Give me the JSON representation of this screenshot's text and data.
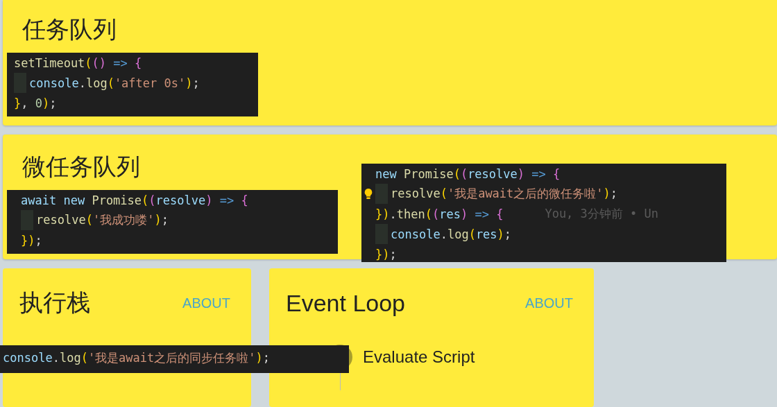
{
  "cards": [
    {
      "title": "任务队列",
      "snippets": [
        {
          "lines": [
            {
              "text": "setTimeout(() => {"
            },
            {
              "indent": true,
              "text": "console.log('after 0s');"
            },
            {
              "text": "}, 0);"
            }
          ]
        }
      ]
    },
    {
      "title": "微任务队列",
      "snippets": [
        {
          "lines": [
            {
              "text": "await new Promise((resolve) => {"
            },
            {
              "indent": true,
              "text": "resolve('我成功喽');"
            },
            {
              "text": "});"
            }
          ]
        },
        {
          "lines": [
            {
              "text": "new Promise((resolve) => {"
            },
            {
              "indent": true,
              "lightbulb": true,
              "text": "resolve('我是await之后的微任务啦');"
            },
            {
              "text": "}).then((res) => {",
              "blame": "You, 3分钟前 • Un"
            },
            {
              "indent": true,
              "text": "console.log(res);"
            },
            {
              "text": "});"
            }
          ]
        }
      ]
    }
  ],
  "panels": [
    {
      "kind": "stack",
      "title": "执行栈",
      "link": "ABOUT"
    },
    {
      "kind": "loop",
      "title": "Event Loop",
      "link": "ABOUT",
      "steps": [
        {
          "label": "Evaluate Script"
        }
      ]
    }
  ],
  "overlay_snippet": {
    "lines": [
      {
        "text": "console.log('我是await之后的同步任务啦');"
      }
    ]
  }
}
